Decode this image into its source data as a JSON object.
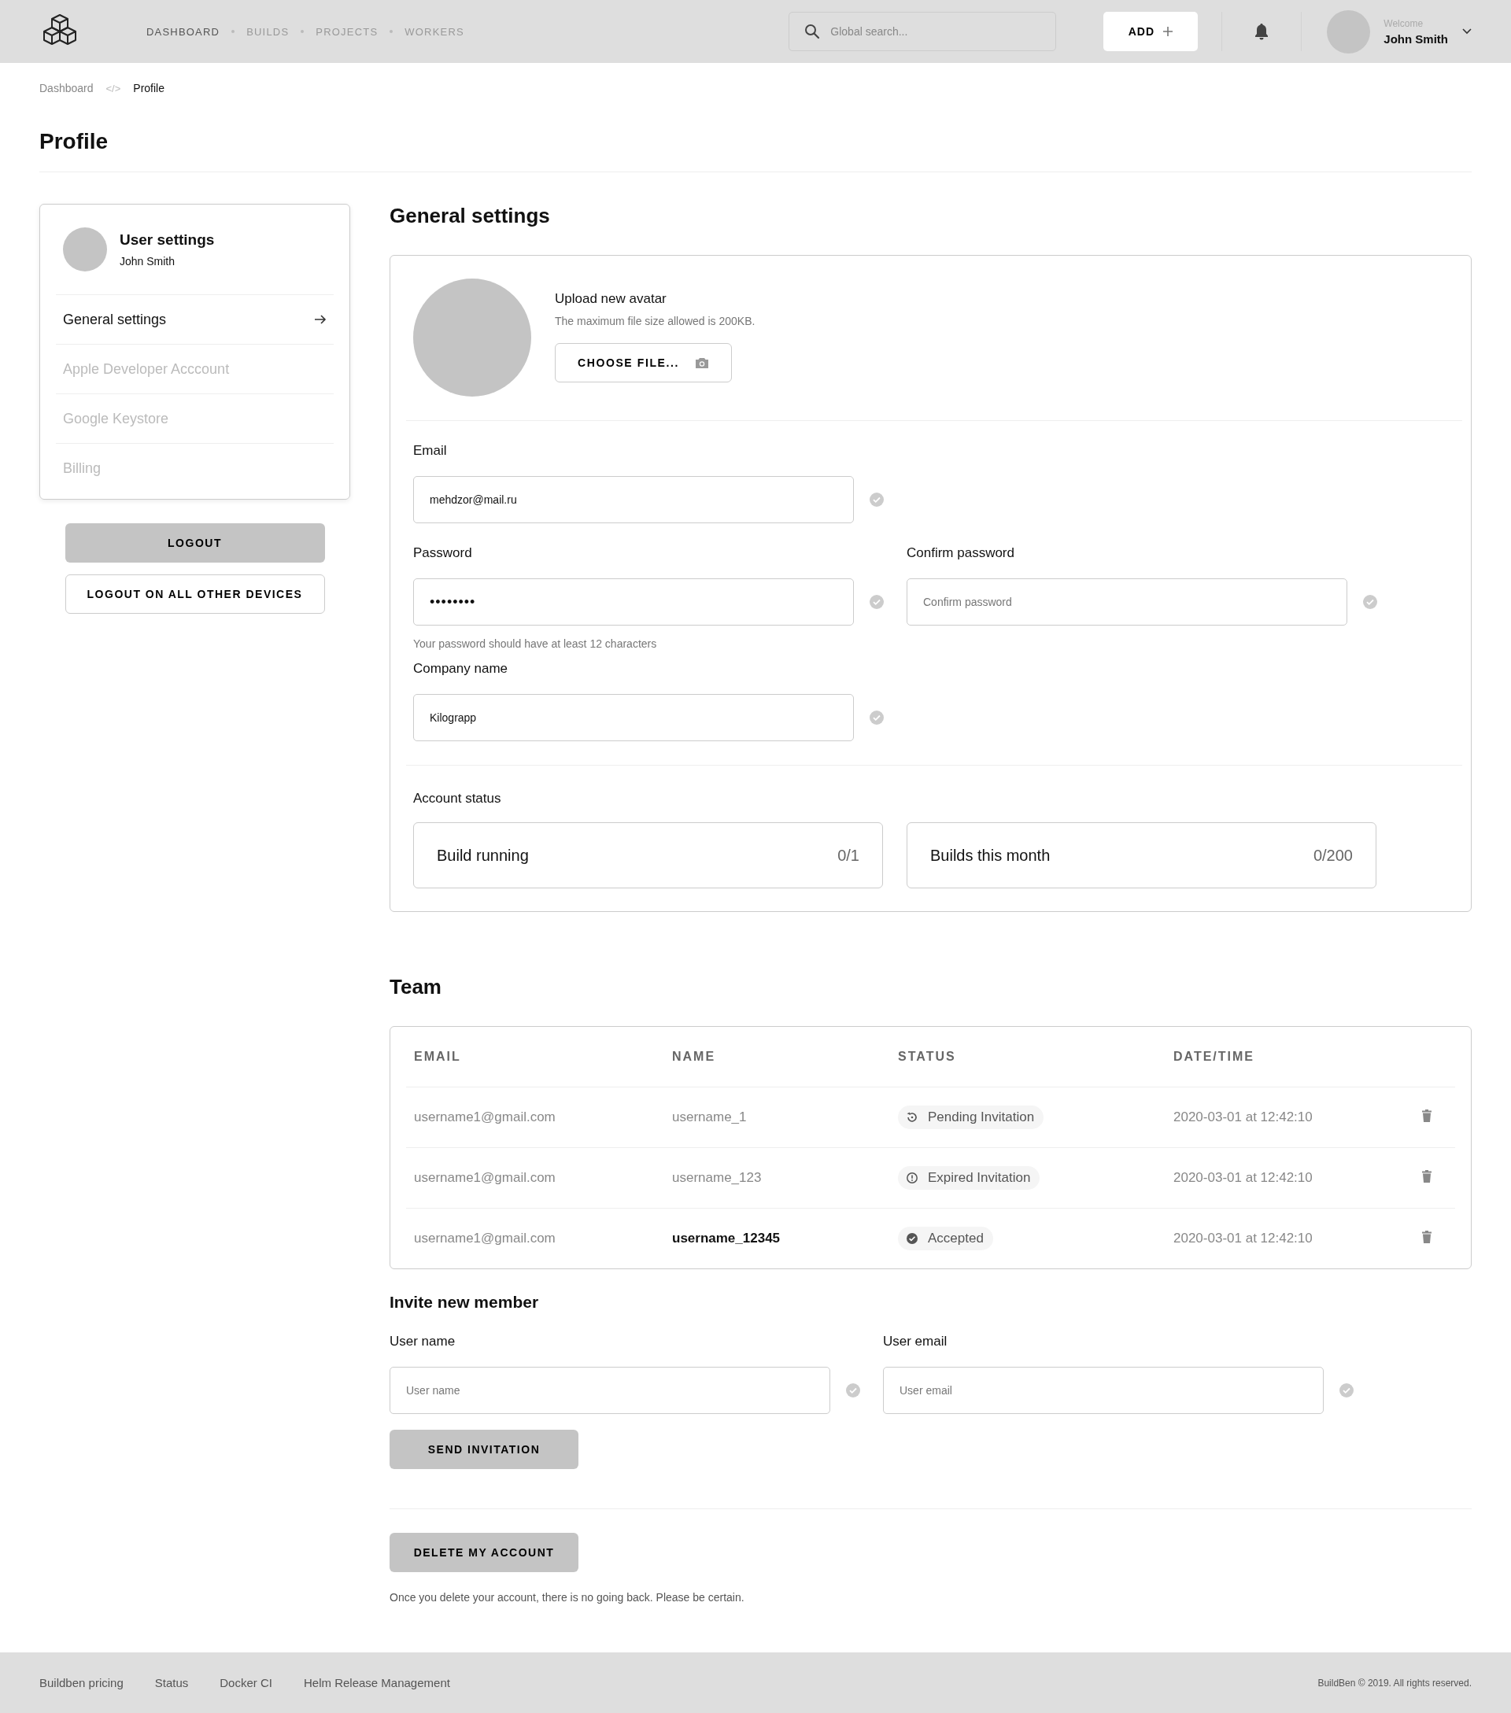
{
  "header": {
    "nav": [
      {
        "label": "DASHBOARD",
        "selected": true
      },
      {
        "label": "BUILDS",
        "selected": false
      },
      {
        "label": "PROJECTS",
        "selected": false
      },
      {
        "label": "WORKERS",
        "selected": false
      }
    ],
    "search": {
      "placeholder": "Global search..."
    },
    "add_button": "ADD",
    "user": {
      "greeting": "Welcome",
      "name": "John Smith"
    }
  },
  "breadcrumb": {
    "items": [
      {
        "label": "Dashboard",
        "current": false
      },
      {
        "label": "Profile",
        "current": true
      }
    ],
    "separator": "</>"
  },
  "page_title": "Profile",
  "sidebar": {
    "title": "User settings",
    "subtitle": "John Smith",
    "items": [
      {
        "label": "General settings",
        "selected": true
      },
      {
        "label": "Apple Developer Acccount",
        "selected": false
      },
      {
        "label": "Google Keystore",
        "selected": false
      },
      {
        "label": "Billing",
        "selected": false
      }
    ],
    "buttons": [
      {
        "label": "LOGOUT",
        "kind": "filled"
      },
      {
        "label": "LOGOUT ON ALL OTHER DEVICES",
        "kind": "outline"
      }
    ]
  },
  "general_settings": {
    "title": "General settings",
    "avatar": {
      "title": "Upload new avatar",
      "hint": "The maximum file size allowed is 200KB.",
      "button": "CHOOSE FILE..."
    },
    "email": {
      "label": "Email",
      "value": "mehdzor@mail.ru"
    },
    "password": {
      "label": "Password",
      "value": "••••••••",
      "hint": "Your password should have at least 12 characters"
    },
    "confirm_password": {
      "label": "Confirm password",
      "placeholder": "Confirm password"
    },
    "company": {
      "label": "Company name",
      "value": "Kilograpp"
    },
    "account_status": {
      "title": "Account status",
      "cards": [
        {
          "label": "Build running",
          "value": "0/1"
        },
        {
          "label": "Builds this month",
          "value": "0/200"
        }
      ]
    }
  },
  "team": {
    "title": "Team",
    "columns": [
      "EMAIL",
      "NAME",
      "STATUS",
      "DATE/TIME"
    ],
    "rows": [
      {
        "email": "username1@gmail.com",
        "name": "username_1",
        "highlighted": false,
        "status": {
          "kind": "pending",
          "label": "Pending Invitation"
        },
        "datetime": "2020-03-01 at 12:42:10"
      },
      {
        "email": "username1@gmail.com",
        "name": "username_123",
        "highlighted": false,
        "status": {
          "kind": "expired",
          "label": "Expired Invitation"
        },
        "datetime": "2020-03-01 at 12:42:10"
      },
      {
        "email": "username1@gmail.com",
        "name": "username_12345",
        "highlighted": true,
        "status": {
          "kind": "accepted",
          "label": "Accepted"
        },
        "datetime": "2020-03-01 at 12:42:10"
      }
    ]
  },
  "invite": {
    "title": "Invite new member",
    "fields": [
      {
        "label": "User name",
        "placeholder": "User name"
      },
      {
        "label": "User email",
        "placeholder": "User email"
      }
    ],
    "button": "SEND INVITATION"
  },
  "delete_account": {
    "button": "DELETE MY ACCOUNT",
    "note": "Once you delete your account, there is no going back. Please be certain."
  },
  "footer": {
    "links": [
      "Buildben pricing",
      "Status",
      "Docker CI",
      "Helm Release Management"
    ],
    "copyright": "BuildBen © 2019. All rights reserved."
  }
}
